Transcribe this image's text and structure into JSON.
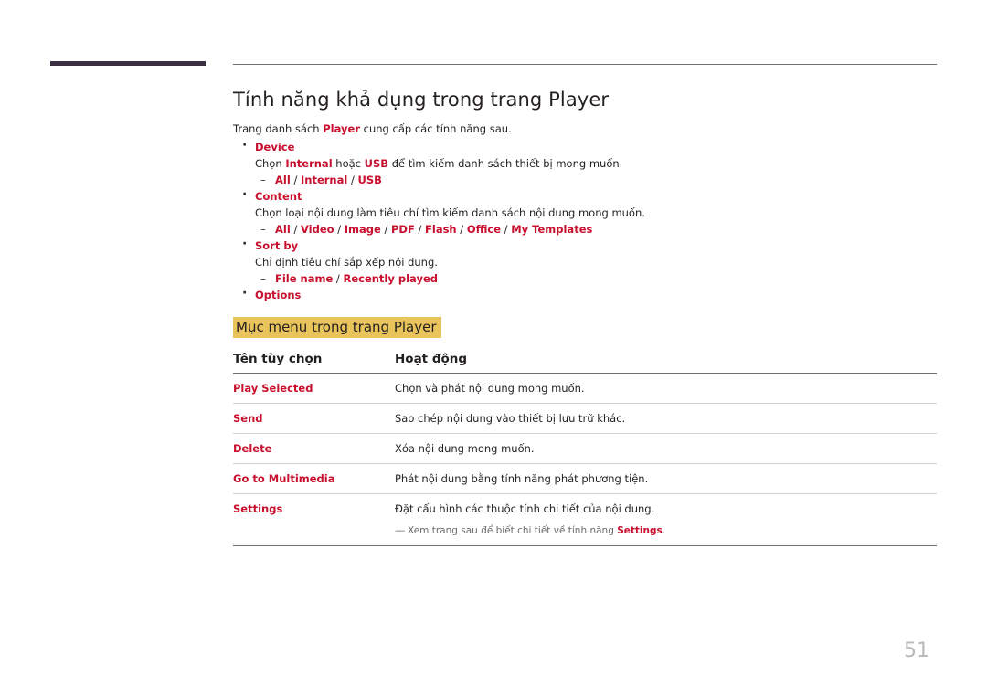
{
  "page": {
    "title": "Tính năng khả dụng trong trang Player",
    "intro_before": "Trang danh sách ",
    "intro_highlight": "Player",
    "intro_after": " cung cấp các tính năng sau.",
    "number": "51"
  },
  "bullets": [
    {
      "head": "Device",
      "desc_parts": [
        {
          "text": "Chọn ",
          "hl": false
        },
        {
          "text": "Internal",
          "hl": true
        },
        {
          "text": " hoặc ",
          "hl": false
        },
        {
          "text": "USB",
          "hl": true
        },
        {
          "text": " để tìm kiếm danh sách thiết bị mong muốn.",
          "hl": false
        }
      ],
      "options": [
        "All",
        "Internal",
        "USB"
      ]
    },
    {
      "head": "Content",
      "desc_parts": [
        {
          "text": "Chọn loại nội dung làm tiêu chí tìm kiếm danh sách nội dung mong muốn.",
          "hl": false
        }
      ],
      "options": [
        "All",
        "Video",
        "Image",
        "PDF",
        "Flash",
        "Office",
        "My Templates"
      ]
    },
    {
      "head": "Sort by",
      "desc_parts": [
        {
          "text": "Chỉ định tiêu chí sắp xếp nội dung.",
          "hl": false
        }
      ],
      "options": [
        "File name",
        "Recently played"
      ]
    },
    {
      "head": "Options",
      "desc_parts": [],
      "options": []
    }
  ],
  "section": {
    "heading": "Mục menu trong trang Player"
  },
  "table": {
    "headers": [
      "Tên tùy chọn",
      "Hoạt động"
    ],
    "rows": [
      {
        "name": "Play Selected",
        "desc": "Chọn và phát nội dung mong muốn."
      },
      {
        "name": "Send",
        "desc": "Sao chép nội dung vào thiết bị lưu trữ khác."
      },
      {
        "name": "Delete",
        "desc": "Xóa nội dung mong muốn."
      },
      {
        "name": "Go to Multimedia",
        "desc": "Phát nội dung bằng tính năng phát phương tiện."
      },
      {
        "name": "Settings",
        "desc": "Đặt cấu hình các thuộc tính chi tiết của nội dung."
      }
    ],
    "note_before": "Xem trang sau để biết chi tiết về tính năng ",
    "note_highlight": "Settings",
    "note_after": "."
  }
}
